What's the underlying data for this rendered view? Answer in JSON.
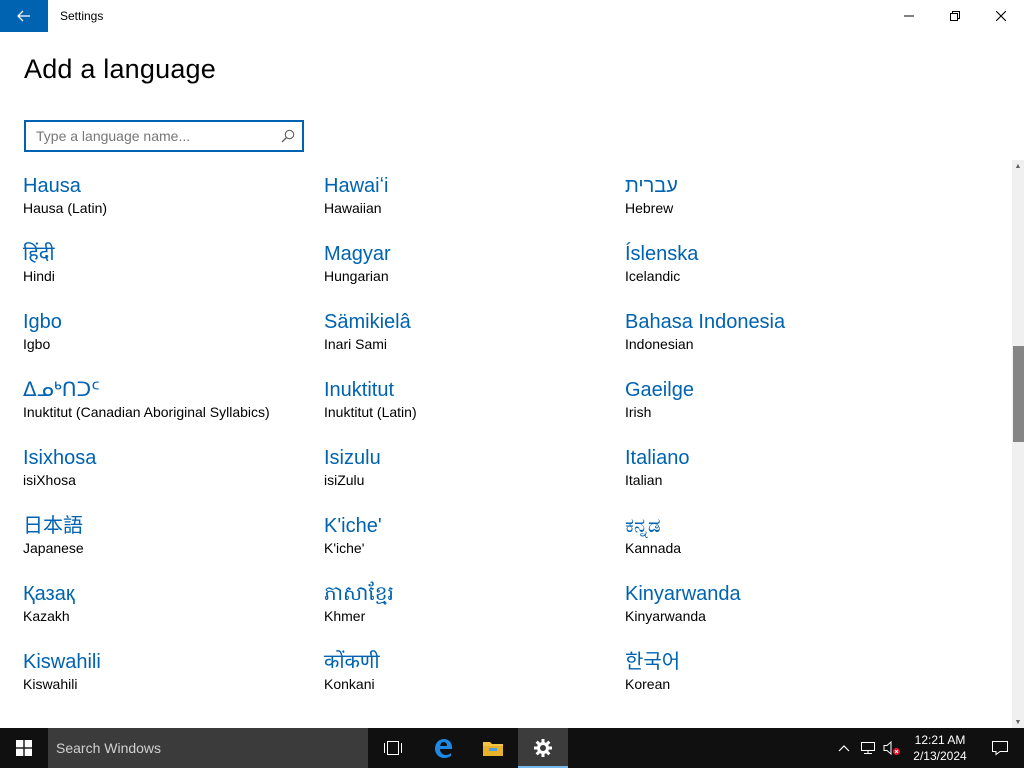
{
  "window": {
    "title": "Settings"
  },
  "page": {
    "title": "Add a language"
  },
  "search": {
    "placeholder": "Type a language name...",
    "value": ""
  },
  "languages": [
    {
      "native": "Hausa",
      "english": "Hausa (Latin)"
    },
    {
      "native": "Hawaiʻi",
      "english": "Hawaiian"
    },
    {
      "native": "עברית",
      "english": "Hebrew"
    },
    {
      "native": "हिंदी",
      "english": "Hindi"
    },
    {
      "native": "Magyar",
      "english": "Hungarian"
    },
    {
      "native": "Íslenska",
      "english": "Icelandic"
    },
    {
      "native": "Igbo",
      "english": "Igbo"
    },
    {
      "native": "Sämikielâ",
      "english": "Inari Sami"
    },
    {
      "native": "Bahasa Indonesia",
      "english": "Indonesian"
    },
    {
      "native": "ᐃᓄᒃᑎᑐᑦ",
      "english": "Inuktitut (Canadian Aboriginal Syllabics)"
    },
    {
      "native": "Inuktitut",
      "english": "Inuktitut (Latin)"
    },
    {
      "native": "Gaeilge",
      "english": "Irish"
    },
    {
      "native": "Isixhosa",
      "english": "isiXhosa"
    },
    {
      "native": "Isizulu",
      "english": "isiZulu"
    },
    {
      "native": "Italiano",
      "english": "Italian"
    },
    {
      "native": "日本語",
      "english": "Japanese"
    },
    {
      "native": "K'iche'",
      "english": "K'iche'"
    },
    {
      "native": "ಕನ್ನಡ",
      "english": "Kannada"
    },
    {
      "native": "Қазақ",
      "english": "Kazakh"
    },
    {
      "native": "ភាសាខ្មែរ",
      "english": "Khmer"
    },
    {
      "native": "Kinyarwanda",
      "english": "Kinyarwanda"
    },
    {
      "native": "Kiswahili",
      "english": "Kiswahili"
    },
    {
      "native": "कोंकणी",
      "english": "Konkani"
    },
    {
      "native": "한국어",
      "english": "Korean"
    }
  ],
  "taskbar": {
    "search_placeholder": "Search Windows",
    "time": "12:21 AM",
    "date": "2/13/2024"
  },
  "colors": {
    "accent": "#0063b1",
    "taskbar": "#101010",
    "taskbar_search": "#3b3b3b"
  }
}
